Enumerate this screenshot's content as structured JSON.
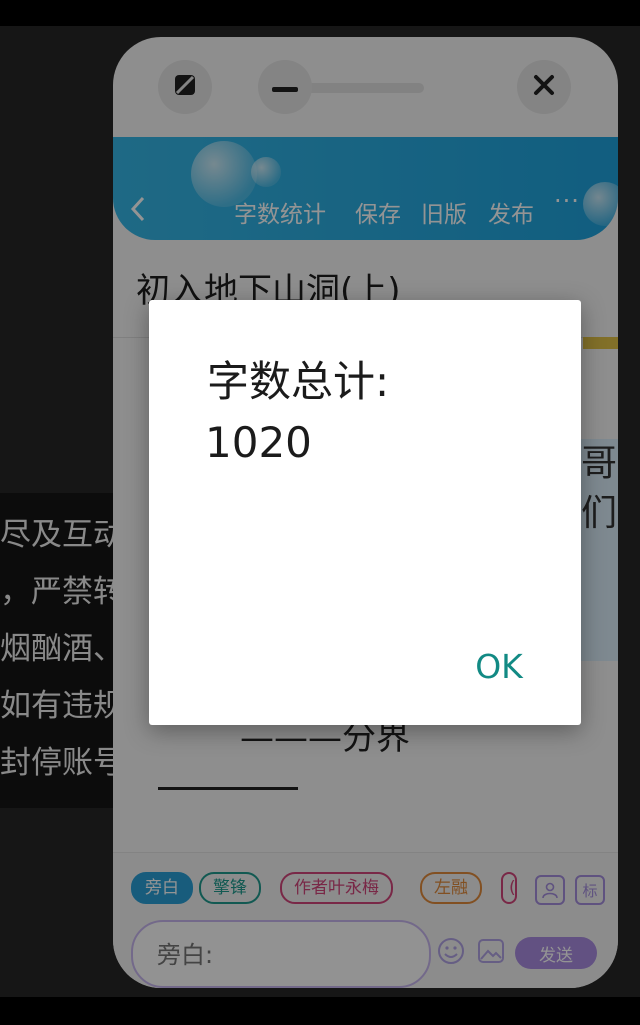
{
  "background": {
    "lines": [
      "尽及互动",
      "，严禁转",
      "烟酗酒、",
      "如有违规",
      "封停账号"
    ]
  },
  "window_controls": {
    "expand_icon": "expand-icon",
    "minimize_icon": "minimize-icon",
    "close_icon": "close-icon"
  },
  "header": {
    "back_icon": "back-chevron-icon",
    "word_count": "字数统计",
    "save": "保存",
    "old_version": "旧版",
    "publish": "发布",
    "more": "···"
  },
  "chapter": {
    "title": "初入地下山洞(上)",
    "partial_text": "哥\n们",
    "divider": "———分界"
  },
  "composer": {
    "tags": [
      {
        "label": "旁白",
        "color": "#2a9fd6",
        "filled": true
      },
      {
        "label": "擎锋",
        "color": "#1f9a8e",
        "filled": false
      },
      {
        "label": "作者叶永梅",
        "color": "#d0457a",
        "filled": false
      },
      {
        "label": "左融",
        "color": "#e08a3c",
        "filled": false
      },
      {
        "label": "(",
        "color": "#d0457a",
        "filled": false
      }
    ],
    "role_icon": "person-icon",
    "mark_label": "标",
    "input_placeholder": "旁白:",
    "emoji_icon": "emoji-icon",
    "image_icon": "image-icon",
    "send": "发送"
  },
  "dialog": {
    "title": "字数总计:",
    "value": "1020",
    "ok": "OK"
  }
}
